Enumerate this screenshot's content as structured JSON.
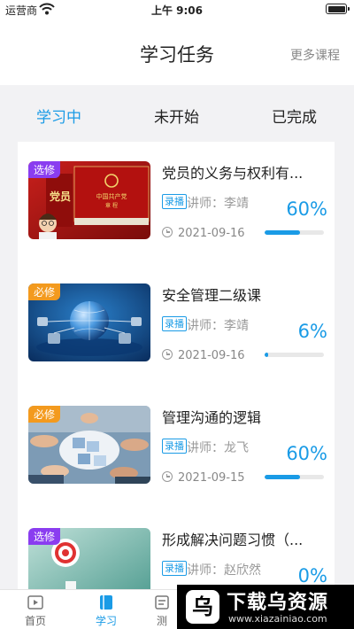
{
  "status_bar": {
    "carrier": "运营商",
    "time": "上午 9:06"
  },
  "header": {
    "title": "学习任务",
    "more_label": "更多课程"
  },
  "tabs": [
    {
      "label": "学习中",
      "active": true
    },
    {
      "label": "未开始",
      "active": false
    },
    {
      "label": "已完成",
      "active": false
    }
  ],
  "courses": [
    {
      "title": "党员的义务与权利有...",
      "tag": "选修",
      "badge": "录播",
      "teacher": "讲师：李靖",
      "date": "2021-09-16",
      "progress_label": "60%",
      "progress": 0.6
    },
    {
      "title": "安全管理二级课",
      "tag": "必修",
      "badge": "录播",
      "teacher": "讲师：李靖",
      "date": "2021-09-16",
      "progress_label": "6%",
      "progress": 0.06
    },
    {
      "title": "管理沟通的逻辑",
      "tag": "必修",
      "badge": "录播",
      "teacher": "讲师：龙飞",
      "date": "2021-09-15",
      "progress_label": "60%",
      "progress": 0.6
    },
    {
      "title": "形成解决问题习惯（...",
      "tag": "选修",
      "badge": "录播",
      "teacher": "讲师：赵欣然",
      "date": "",
      "progress_label": "0%",
      "progress": 0
    }
  ],
  "thumbnails": {
    "book_cover_small": "中国共产党",
    "book_cover_large": "章 程",
    "party_badge": "党员"
  },
  "tab_bar": [
    {
      "label": "首页",
      "icon": "video-icon"
    },
    {
      "label": "学习",
      "icon": "book-icon",
      "active": true
    },
    {
      "label": "测",
      "icon": "test-icon"
    }
  ],
  "watermark": {
    "logo": "乌",
    "text": "下载乌资源",
    "url": "www.xiazainiao.com"
  },
  "colors": {
    "accent": "#1a9be6",
    "elective_tag": "#8a3df0",
    "required_tag": "#f39a1e"
  }
}
